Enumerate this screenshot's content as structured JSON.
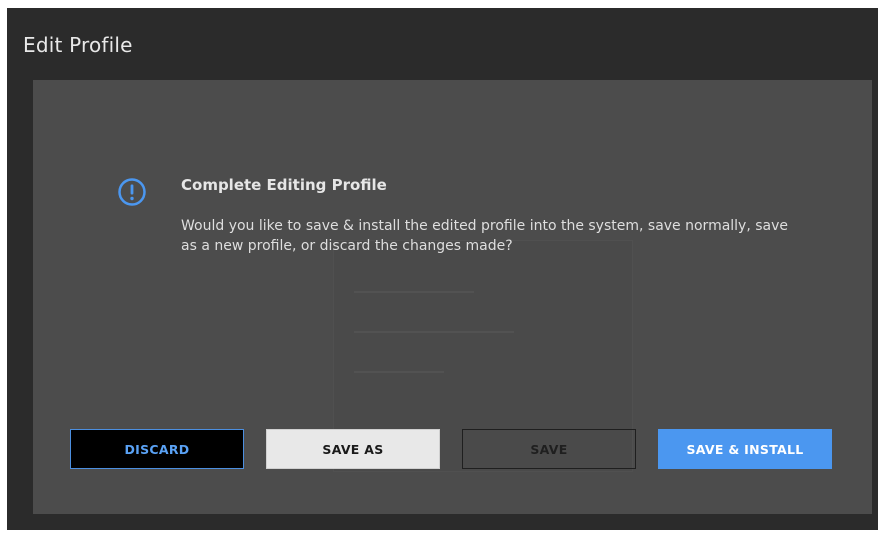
{
  "window": {
    "title": "Edit Profile"
  },
  "dialog": {
    "icon": "alert-circle-icon",
    "title": "Complete Editing Profile",
    "message": "Would you like to save & install the edited profile into the system, save normally, save as a new profile, or discard the changes made?",
    "buttons": {
      "discard": "DISCARD",
      "save_as": "SAVE AS",
      "save": "SAVE",
      "save_install": "SAVE & INSTALL"
    }
  },
  "colors": {
    "accent": "#4b97f0",
    "window_bg": "#2b2b2b",
    "dialog_bg": "#4c4c4c"
  }
}
